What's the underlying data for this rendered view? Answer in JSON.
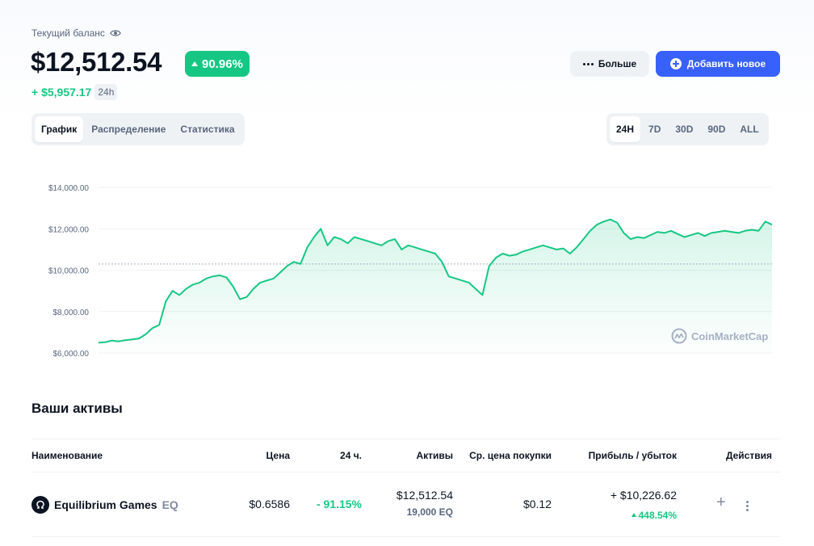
{
  "balance": {
    "label": "Текущий баланс",
    "amount": "$12,512.54",
    "change_pct": "90.96%",
    "pnl_value": "+ $5,957.17",
    "pnl_period": "24h"
  },
  "actions": {
    "more_label": "Больше",
    "add_label": "Добавить новое"
  },
  "view_tabs": [
    {
      "label": "График",
      "active": true
    },
    {
      "label": "Распределение",
      "active": false
    },
    {
      "label": "Статистика",
      "active": false
    }
  ],
  "period_tabs": [
    {
      "label": "24H",
      "active": true
    },
    {
      "label": "7D",
      "active": false
    },
    {
      "label": "30D",
      "active": false
    },
    {
      "label": "90D",
      "active": false
    },
    {
      "label": "ALL",
      "active": false
    }
  ],
  "chart_data": {
    "type": "area",
    "y_ticks": [
      "$14,000.00",
      "$12,000.00",
      "$10,000.00",
      "$8,000.00",
      "$6,000.00"
    ],
    "y_tick_values": [
      14000,
      12000,
      10000,
      8000,
      6000
    ],
    "ylim": [
      6000,
      14000
    ],
    "reference_line": 10300,
    "x": [
      0,
      1,
      2,
      3,
      4,
      5,
      6,
      7,
      8,
      9,
      10,
      11,
      12,
      13,
      14,
      15,
      16,
      17,
      18,
      19,
      20,
      21,
      22,
      23,
      24,
      25,
      26,
      27,
      28,
      29,
      30,
      31,
      32,
      33,
      34,
      35,
      36,
      37,
      38,
      39,
      40,
      41,
      42,
      43,
      44,
      45,
      46,
      47,
      48,
      49,
      50,
      51,
      52,
      53,
      54,
      55,
      56,
      57,
      58,
      59,
      60,
      61,
      62,
      63,
      64,
      65,
      66,
      67,
      68,
      69,
      70,
      71,
      72,
      73,
      74,
      75,
      76,
      77,
      78,
      79,
      80,
      81,
      82,
      83,
      84,
      85,
      86,
      87,
      88,
      89,
      90,
      91,
      92,
      93,
      94,
      95,
      96,
      97,
      98,
      99,
      100
    ],
    "values": [
      6500,
      6520,
      6600,
      6560,
      6620,
      6650,
      6700,
      6900,
      7200,
      7350,
      8500,
      9000,
      8800,
      9100,
      9300,
      9400,
      9600,
      9700,
      9750,
      9650,
      9200,
      8600,
      8700,
      9100,
      9400,
      9500,
      9600,
      9900,
      10200,
      10400,
      10300,
      11100,
      11600,
      12000,
      11200,
      11600,
      11500,
      11300,
      11600,
      11500,
      11400,
      11300,
      11200,
      11400,
      11500,
      11000,
      11200,
      11100,
      11000,
      10900,
      10800,
      10400,
      9700,
      9600,
      9500,
      9400,
      9100,
      8800,
      10200,
      10600,
      10800,
      10700,
      10750,
      10900,
      11000,
      11100,
      11200,
      11100,
      11000,
      11050,
      10800,
      11100,
      11500,
      11900,
      12200,
      12350,
      12450,
      12300,
      11800,
      11500,
      11600,
      11550,
      11700,
      11850,
      11800,
      11900,
      11750,
      11600,
      11700,
      11800,
      11650,
      11800,
      11850,
      11900,
      11850,
      11800,
      11900,
      11950,
      11900,
      12350,
      12200
    ]
  },
  "watermark": "CoinMarketCap",
  "holdings": {
    "title": "Ваши активы",
    "columns": [
      "Наименование",
      "Цена",
      "24 ч.",
      "Активы",
      "Ср. цена покупки",
      "Прибыль / убыток",
      "Действия"
    ],
    "rows": [
      {
        "name": "Equilibrium Games",
        "symbol": "EQ",
        "price": "$0.6586",
        "change_24h": "- 91.15%",
        "holdings_value": "$12,512.54",
        "holdings_amount": "19,000 EQ",
        "avg_buy_price": "$0.12",
        "pnl_value": "+ $10,226.62",
        "pnl_pct": "448.54%"
      }
    ]
  },
  "colors": {
    "accent": "#3861fb",
    "positive": "#16c784",
    "text": "#0d1421",
    "muted": "#58667e"
  }
}
